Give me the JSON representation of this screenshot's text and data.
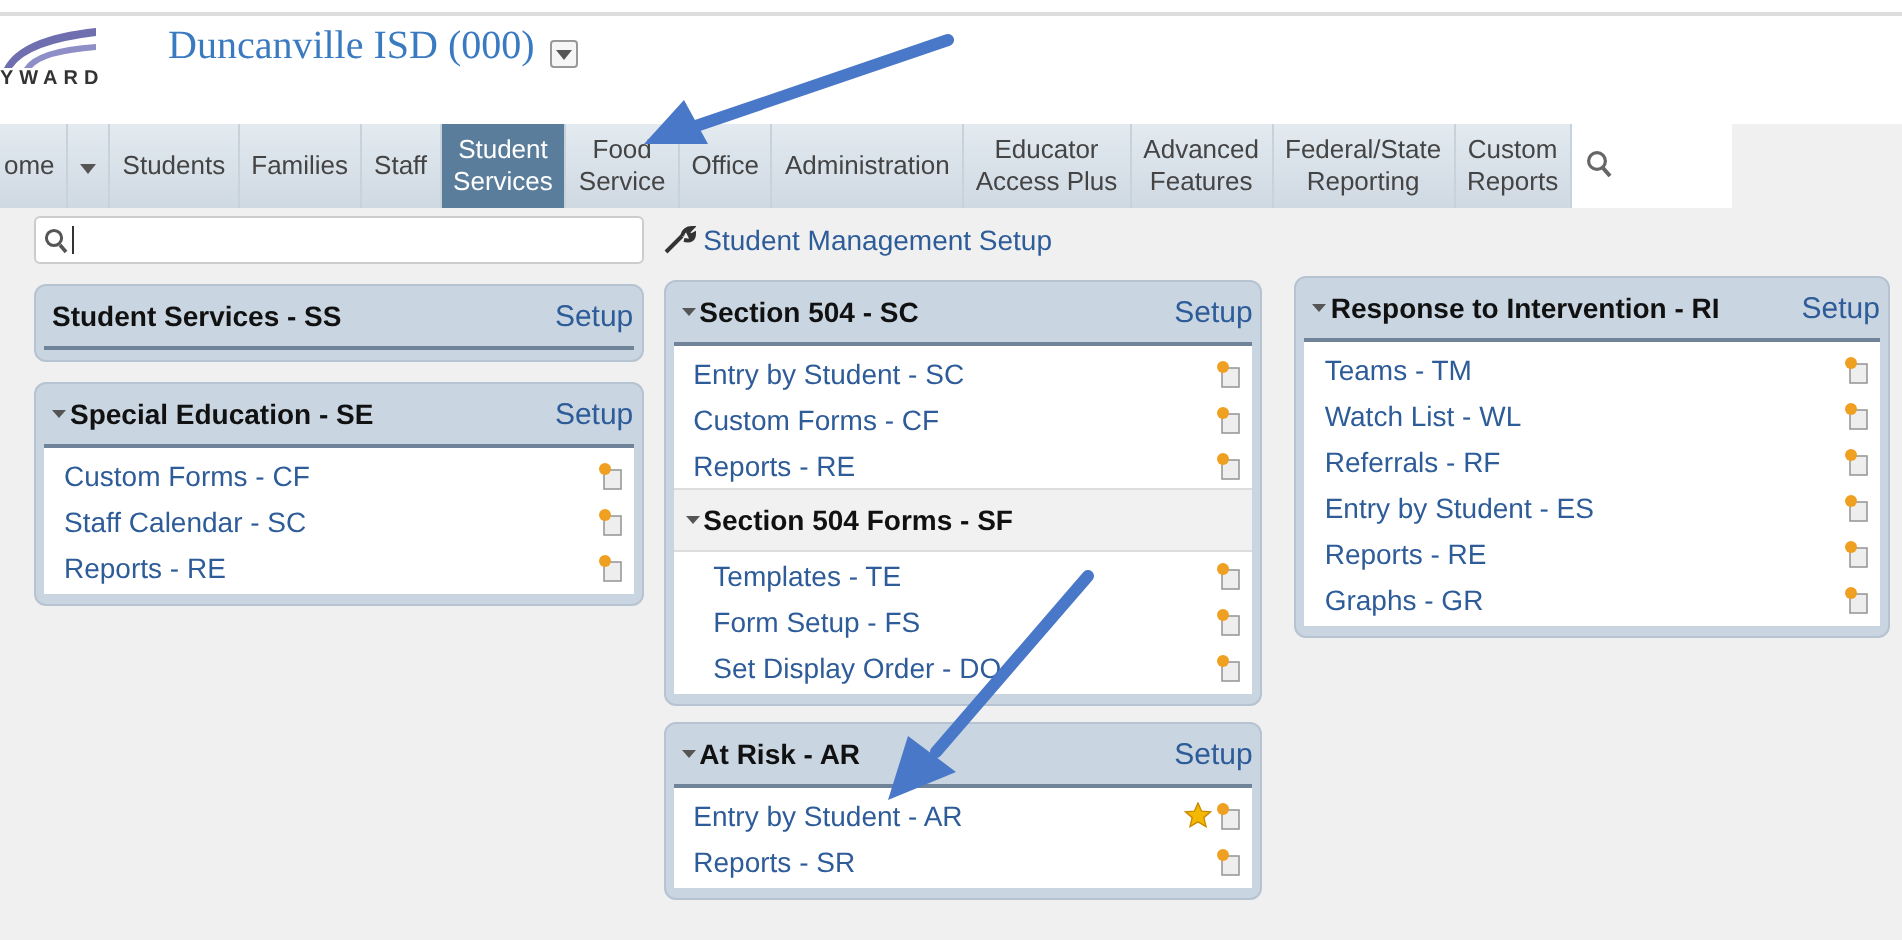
{
  "header": {
    "logo_text": "YWARD",
    "district": "Duncanville ISD (000)"
  },
  "nav": [
    {
      "label": "ome",
      "selected": false,
      "dropdown": true
    },
    {
      "label": "Students",
      "selected": false,
      "dropdown": false
    },
    {
      "label": "Families",
      "selected": false,
      "dropdown": false
    },
    {
      "label": "Staff",
      "selected": false,
      "dropdown": false
    },
    {
      "label": "Student\nServices",
      "selected": true,
      "dropdown": false
    },
    {
      "label": "Food\nService",
      "selected": false,
      "dropdown": false
    },
    {
      "label": "Office",
      "selected": false,
      "dropdown": false
    },
    {
      "label": "Administration",
      "selected": false,
      "dropdown": false
    },
    {
      "label": "Educator\nAccess Plus",
      "selected": false,
      "dropdown": false
    },
    {
      "label": "Advanced\nFeatures",
      "selected": false,
      "dropdown": false
    },
    {
      "label": "Federal/State\nReporting",
      "selected": false,
      "dropdown": false
    },
    {
      "label": "Custom\nReports",
      "selected": false,
      "dropdown": false
    }
  ],
  "setup_link": "Student Management Setup",
  "columns": [
    [
      {
        "title": "Student Services - SS",
        "collapsible": false,
        "setup": "Setup"
      },
      {
        "title": "Special Education - SE",
        "collapsible": true,
        "setup": "Setup",
        "items": [
          {
            "label": "Custom Forms - CF",
            "favorite": false
          },
          {
            "label": "Staff Calendar - SC",
            "favorite": false
          },
          {
            "label": "Reports - RE",
            "favorite": false
          }
        ]
      }
    ],
    [
      {
        "title": "Section 504 - SC",
        "collapsible": true,
        "setup": "Setup",
        "items": [
          {
            "label": "Entry by Student - SC",
            "favorite": false
          },
          {
            "label": "Custom Forms - CF",
            "favorite": false
          },
          {
            "label": "Reports - RE",
            "favorite": false
          }
        ],
        "subsection": {
          "title": "Section 504 Forms - SF",
          "items": [
            {
              "label": "Templates - TE",
              "favorite": false
            },
            {
              "label": "Form Setup - FS",
              "favorite": false
            },
            {
              "label": "Set Display Order - DO",
              "favorite": false
            }
          ]
        }
      },
      {
        "title": "At Risk - AR",
        "collapsible": true,
        "setup": "Setup",
        "items": [
          {
            "label": "Entry by Student - AR",
            "favorite": true
          },
          {
            "label": "Reports - SR",
            "favorite": false
          }
        ]
      }
    ],
    [
      {
        "title": "Response to Intervention - RI",
        "collapsible": true,
        "setup": "Setup",
        "items": [
          {
            "label": "Teams - TM",
            "favorite": false
          },
          {
            "label": "Watch List - WL",
            "favorite": false
          },
          {
            "label": "Referrals - RF",
            "favorite": false
          },
          {
            "label": "Entry by Student - ES",
            "favorite": false
          },
          {
            "label": "Reports - RE",
            "favorite": false
          },
          {
            "label": "Graphs - GR",
            "favorite": false
          }
        ]
      }
    ]
  ]
}
